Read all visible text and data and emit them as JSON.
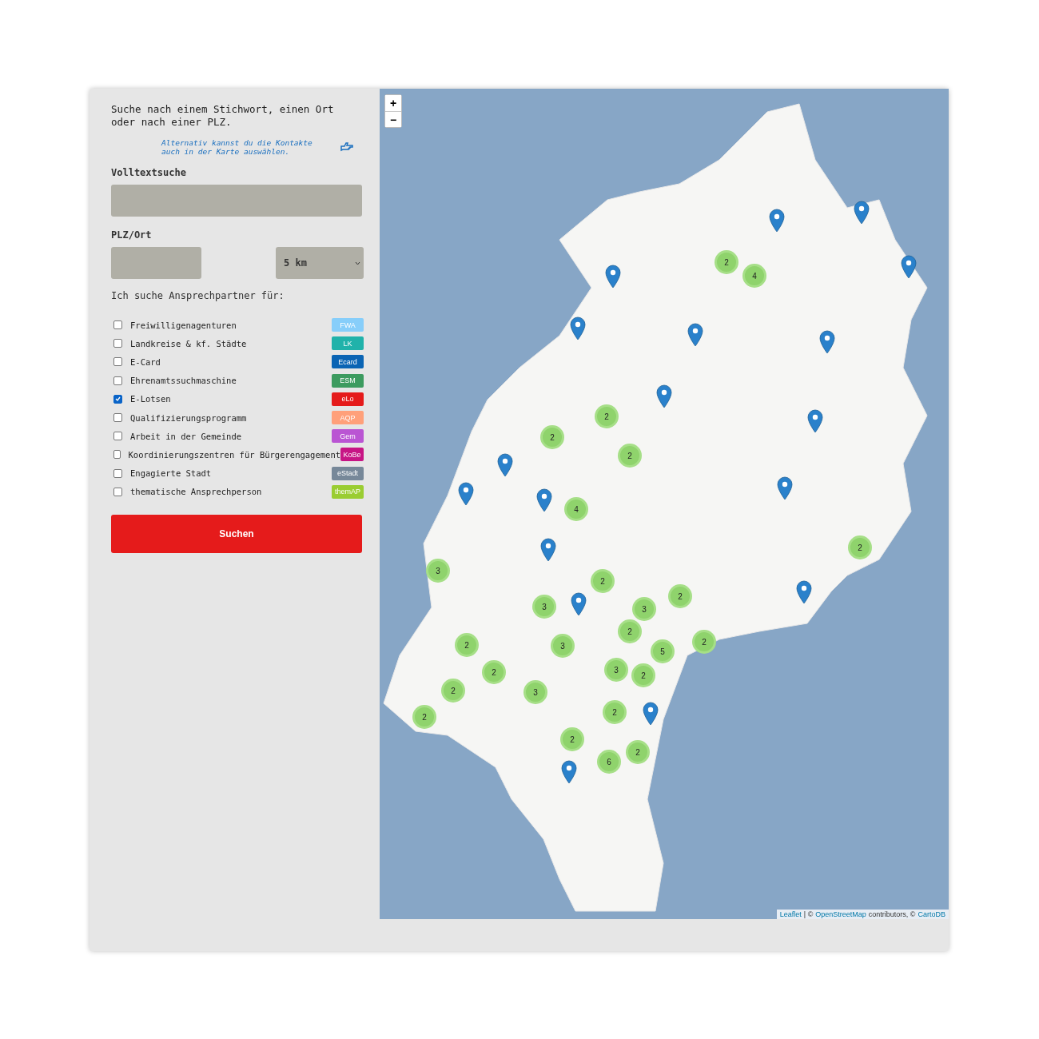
{
  "sidebar": {
    "intro": "Suche nach einem Stichwort, einen Ort oder nach einer PLZ.",
    "hint": "Alternativ kannst du die Kontakte auch in der Karte auswählen.",
    "fulltext": {
      "label": "Volltextsuche"
    },
    "location": {
      "label": "PLZ/Ort",
      "radius": "5 km"
    },
    "filter_heading": "Ich suche Ansprechpartner für:",
    "filters": [
      {
        "label": "Freiwilligenagenturen",
        "tag": "FWA",
        "color": "#87cefa",
        "checked": false
      },
      {
        "label": "Landkreise & kf. Städte",
        "tag": "LK",
        "color": "#20b2aa",
        "checked": false
      },
      {
        "label": "E-Card",
        "tag": "Ecard",
        "color": "#0a64b4",
        "checked": false
      },
      {
        "label": "Ehrenamtssuchmaschine",
        "tag": "ESM",
        "color": "#3c9b5f",
        "checked": false
      },
      {
        "label": "E-Lotsen",
        "tag": "eLo",
        "color": "#e51b1b",
        "checked": true
      },
      {
        "label": "Qualifizierungsprogramm",
        "tag": "AQP",
        "color": "#ffa07a",
        "checked": false
      },
      {
        "label": "Arbeit in der Gemeinde",
        "tag": "Gem",
        "color": "#ba55d3",
        "checked": false
      },
      {
        "label": "Koordinierungszentren für Bürgerengagement",
        "tag": "KoBe",
        "color": "#c71585",
        "checked": false
      },
      {
        "label": "Engagierte Stadt",
        "tag": "eStadt",
        "color": "#778899",
        "checked": false
      },
      {
        "label": "thematische Ansprechperson",
        "tag": "themAP",
        "color": "#9acd32",
        "checked": false
      }
    ],
    "submit": "Suchen"
  },
  "map": {
    "zoom_in": "+",
    "zoom_out": "−",
    "clusters": [
      "2",
      "4",
      "2",
      "2",
      "2",
      "4",
      "2",
      "3",
      "2",
      "3",
      "3",
      "2",
      "2",
      "2",
      "3",
      "5",
      "2",
      "2",
      "3",
      "2",
      "2",
      "3",
      "2",
      "2",
      "2",
      "2",
      "6"
    ],
    "attribution": {
      "leaflet": "Leaflet",
      "sep": "| ©",
      "osm": "OpenStreetMap",
      "contrib": "contributors, ©",
      "carto": "CartoDB"
    }
  }
}
